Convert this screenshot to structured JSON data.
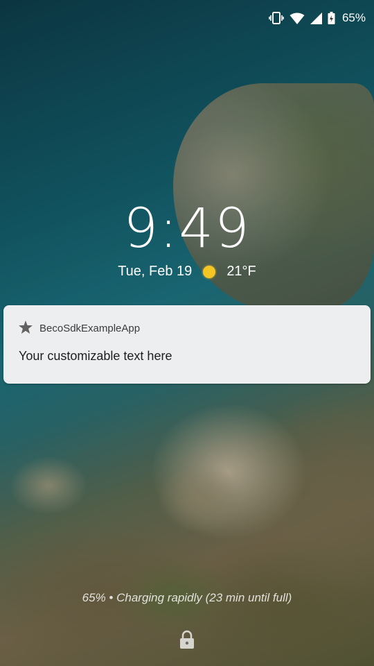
{
  "status_bar": {
    "icons": [
      "vibrate-icon",
      "wifi-icon",
      "cellular-signal-icon",
      "battery-charging-icon"
    ],
    "battery_percent": "65%"
  },
  "lockscreen": {
    "time": "9:49",
    "date": "Tue, Feb 19",
    "weather_icon": "sun-icon",
    "temperature": "21°F"
  },
  "notification": {
    "app_icon": "star-icon",
    "app_name": "BecoSdkExampleApp",
    "text": "Your customizable text here"
  },
  "charging_status": "65% • Charging rapidly (23 min until full)",
  "bottom_icon": "lock-icon"
}
